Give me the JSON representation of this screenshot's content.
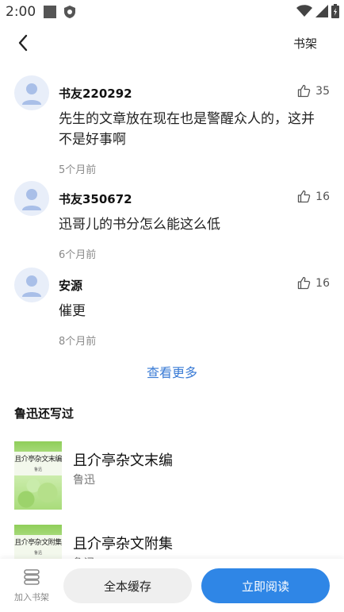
{
  "status": {
    "time": "2:00",
    "left_icons": [
      "square-icon",
      "shield-icon"
    ],
    "right_icons": [
      "wifi-icon",
      "signal-icon",
      "battery-icon"
    ]
  },
  "nav": {
    "back_icon": "back-chevron-icon",
    "shelf_label": "书架"
  },
  "comments": [
    {
      "user": "书友220292",
      "likes": "35",
      "text": "先生的文章放在现在也是警醒众人的，这并不是好事啊",
      "time": "5个月前"
    },
    {
      "user": "书友350672",
      "likes": "16",
      "text": "迅哥儿的书分怎么能这么低",
      "time": "6个月前"
    },
    {
      "user": "安源",
      "likes": "16",
      "text": "催更",
      "time": "8个月前"
    }
  ],
  "see_more": "查看更多",
  "section_title": "鲁迅还写过",
  "books": [
    {
      "title": "且介亭杂文末编",
      "author": "鲁迅",
      "cover_title": "且介亭杂文末编"
    },
    {
      "title": "且介亭杂文附集",
      "author": "鲁迅",
      "cover_title": "且介亭杂文附集"
    }
  ],
  "bottom": {
    "add_shelf": "加入书架",
    "cache": "全本缓存",
    "read": "立即阅读"
  },
  "colors": {
    "accent": "#2f86e6",
    "link": "#3a7bd5",
    "muted": "#8a8a8a",
    "avatar_bg": "#e8eef9",
    "avatar_fg": "#a9bfe8"
  }
}
